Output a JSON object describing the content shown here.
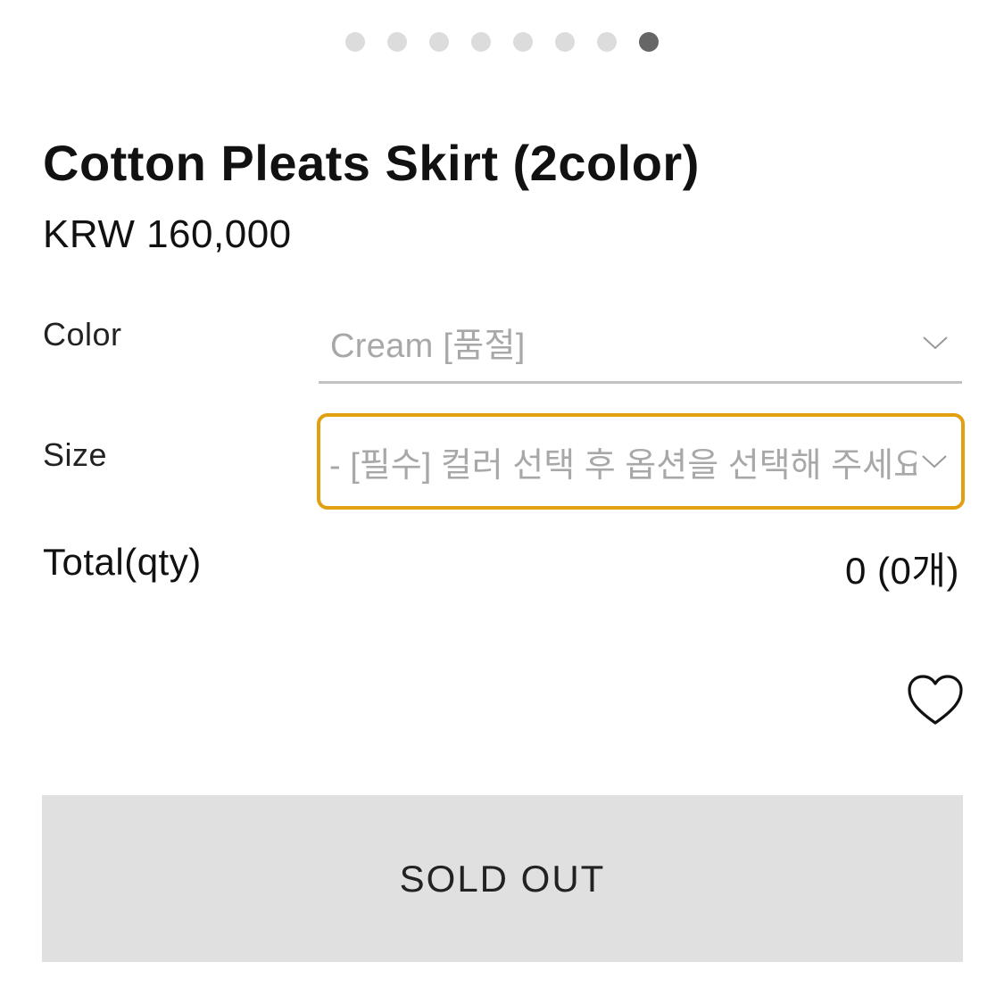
{
  "carousel": {
    "dot_count": 8,
    "active_index": 7
  },
  "product": {
    "title": "Cotton Pleats Skirt (2color)",
    "price": "KRW 160,000"
  },
  "options": {
    "color": {
      "label": "Color",
      "selected": "Cream [품절]"
    },
    "size": {
      "label": "Size",
      "selected": "- [필수] 컬러 선택 후 옵션을 선택해 주세요 -"
    }
  },
  "total": {
    "label": "Total(qty)",
    "value": "0 (0개)"
  },
  "actions": {
    "wishlist_icon": "heart-icon",
    "soldout_label": "SOLD OUT"
  },
  "colors": {
    "focus_border": "#e0a012",
    "placeholder_text": "#a8a8a8",
    "button_bg": "#e0e0e0",
    "dot_inactive": "#dcdcdc",
    "dot_active": "#666666"
  }
}
